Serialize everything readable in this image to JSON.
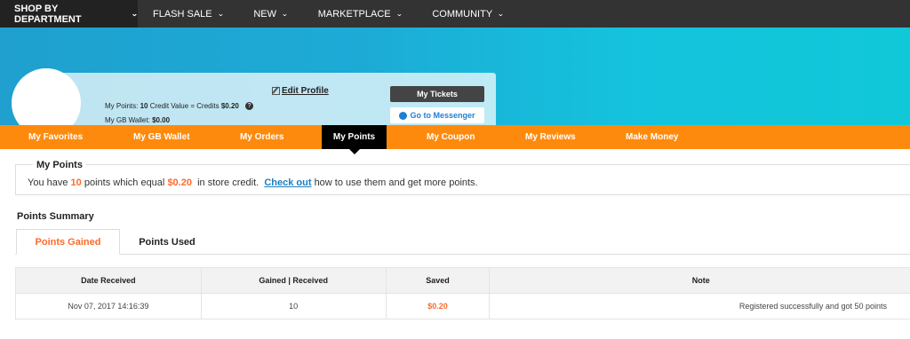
{
  "topnav": {
    "department": "SHOP BY DEPARTMENT",
    "items": [
      "FLASH SALE",
      "NEW",
      "MARKETPLACE",
      "COMMUNITY"
    ]
  },
  "profile": {
    "edit_profile": "Edit Profile",
    "points_label": "My Points:",
    "points_value": "10",
    "credit_label": "Credit Value = Credits",
    "credit_value": "$0.20",
    "wallet_label": "My GB Wallet:",
    "wallet_value": "$0.00",
    "tickets_button": "My Tickets",
    "messenger_button": "Go to Messenger"
  },
  "tabs": [
    "My Favorites",
    "My GB Wallet",
    "My Orders",
    "My Points",
    "My Coupon",
    "My Reviews",
    "Make Money"
  ],
  "active_tab": "My Points",
  "points_box": {
    "legend": "My Points",
    "text_1": "You have",
    "points": "10",
    "text_2": "points which equal",
    "value": "$0.20",
    "text_3": "in store credit.",
    "check_out": "Check out",
    "text_4": "how to use them and get more points."
  },
  "summary": {
    "title": "Points Summary",
    "tab_gained": "Points Gained",
    "tab_used": "Points Used"
  },
  "table": {
    "headers": [
      "Date Received",
      "Gained | Received",
      "Saved",
      "Note"
    ],
    "rows": [
      [
        "Nov 07, 2017 14:16:39",
        "10",
        "$0.20",
        "Registered successfully and got 50 points"
      ]
    ]
  },
  "colors": {
    "accent": "#fe8a0d",
    "highlight": "#fe6a2c",
    "link": "#1e7fbf",
    "nav": "#333333"
  }
}
